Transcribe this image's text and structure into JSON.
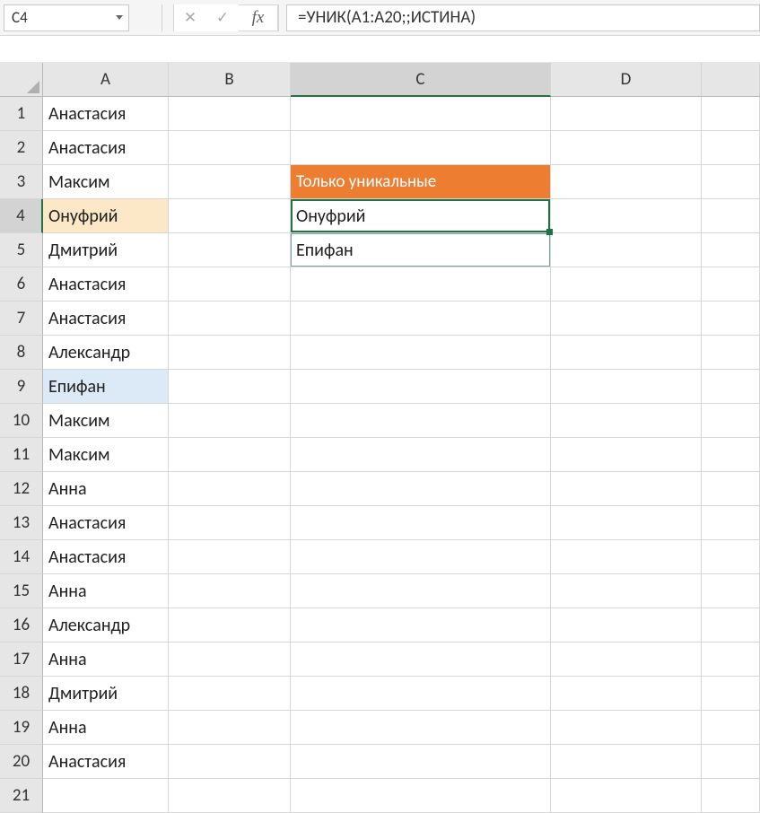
{
  "name_box": "C4",
  "formula_bar": {
    "fx_label": "fx",
    "formula": "=УНИК(A1:A20;;ИСТИНА)"
  },
  "columns": [
    "A",
    "B",
    "C",
    "D"
  ],
  "active_column": "C",
  "active_row": 4,
  "rows": [
    {
      "n": 1,
      "A": "Анастасия"
    },
    {
      "n": 2,
      "A": "Анастасия"
    },
    {
      "n": 3,
      "A": "Максим",
      "C": "Только уникальные",
      "C_style": "orange-hdr"
    },
    {
      "n": 4,
      "A": "Онуфрий",
      "A_style": "highlight-yellow",
      "C": "Онуфрий",
      "C_style": "selected"
    },
    {
      "n": 5,
      "A": "Дмитрий",
      "C": "Епифан",
      "C_style": "spill"
    },
    {
      "n": 6,
      "A": "Анастасия"
    },
    {
      "n": 7,
      "A": "Анастасия"
    },
    {
      "n": 8,
      "A": "Александр"
    },
    {
      "n": 9,
      "A": "Епифан",
      "A_style": "highlight-blue"
    },
    {
      "n": 10,
      "A": "Максим"
    },
    {
      "n": 11,
      "A": "Максим"
    },
    {
      "n": 12,
      "A": "Анна"
    },
    {
      "n": 13,
      "A": "Анастасия"
    },
    {
      "n": 14,
      "A": "Анастасия"
    },
    {
      "n": 15,
      "A": "Анна"
    },
    {
      "n": 16,
      "A": "Александр"
    },
    {
      "n": 17,
      "A": "Анна"
    },
    {
      "n": 18,
      "A": "Дмитрий"
    },
    {
      "n": 19,
      "A": "Анна"
    },
    {
      "n": 20,
      "A": "Анастасия"
    },
    {
      "n": 21,
      "A": ""
    }
  ]
}
